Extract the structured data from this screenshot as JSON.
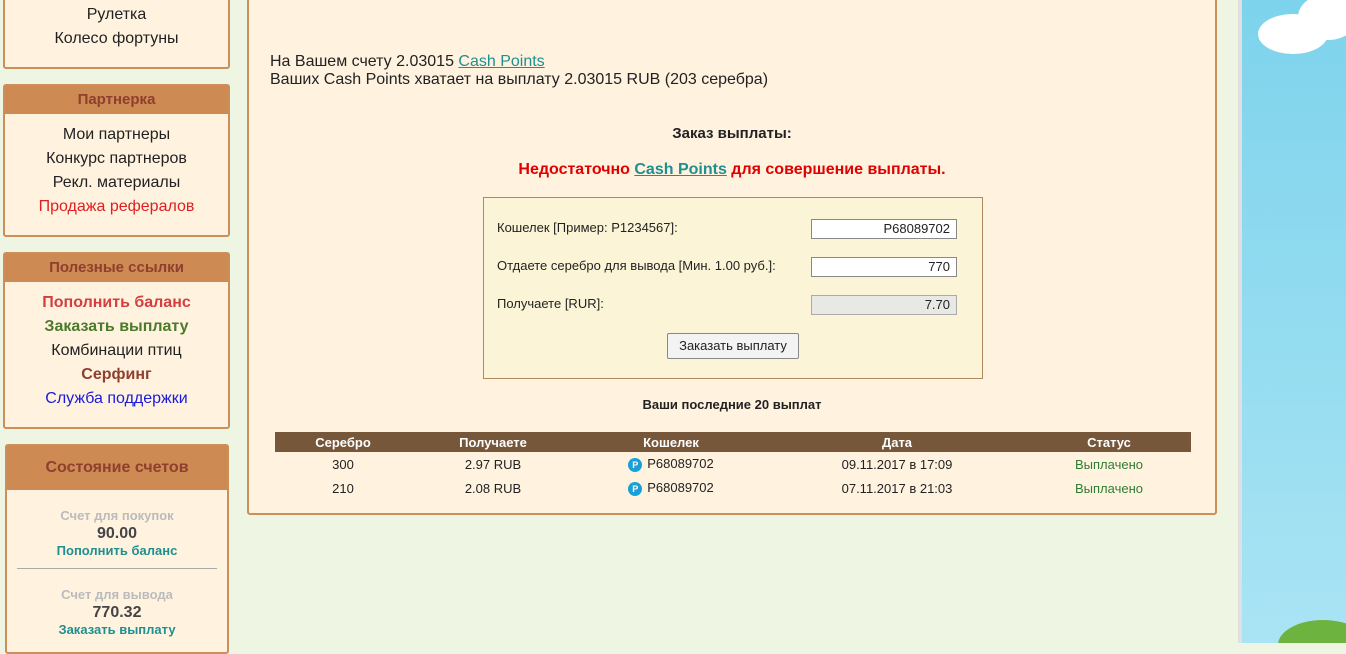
{
  "games": {
    "items": [
      "Рулетка",
      "Колесо фортуны"
    ]
  },
  "partners": {
    "title": "Партнерка",
    "items": [
      "Мои партнеры",
      "Конкурс партнеров",
      "Рекл. материалы",
      "Продажа рефералов"
    ]
  },
  "links": {
    "title": "Полезные ссылки",
    "items": [
      "Пополнить баланс",
      "Заказать выплату",
      "Комбинации птиц",
      "Серфинг",
      "Служба поддержки"
    ]
  },
  "accounts": {
    "title": "Состояние счетов",
    "buy_label": "Счет для покупок",
    "buy_value": "90.00",
    "buy_link": "Пополнить баланс",
    "withdraw_label": "Счет для вывода",
    "withdraw_value": "770.32",
    "withdraw_link": "Заказать выплату"
  },
  "main": {
    "balance_prefix": "На Вашем счету 2.03015 ",
    "cash_points": "Cash Points",
    "enough_line": "Ваших Cash Points хватает на выплату 2.03015 RUB (203 серебра)",
    "order_title": "Заказ выплаты:",
    "error_prefix": "Недостаточно ",
    "error_suffix": " для совершение выплаты."
  },
  "form": {
    "wallet_label": "Кошелек [Пример: P1234567]:",
    "wallet_value": "P68089702",
    "silver_label": "Отдаете серебро для вывода [Мин. 1.00 руб.]:",
    "silver_value": "770",
    "receive_label": "Получаете [RUR]:",
    "receive_value": "7.70",
    "submit_label": "Заказать выплату"
  },
  "history": {
    "title": "Ваши последние 20 выплат",
    "columns": [
      "Серебро",
      "Получаете",
      "Кошелек",
      "Дата",
      "Статус"
    ],
    "rows": [
      [
        "300",
        "2.97 RUB",
        "P68089702",
        "09.11.2017 в 17:09",
        "Выплачено"
      ],
      [
        "210",
        "2.08 RUB",
        "P68089702",
        "07.11.2017 в 21:03",
        "Выплачено"
      ]
    ]
  },
  "colors": {
    "accent_orange": "#cd8a52",
    "status_green": "#2e7d32",
    "error_red": "#e00000",
    "link_teal": "#1f8f8f"
  }
}
